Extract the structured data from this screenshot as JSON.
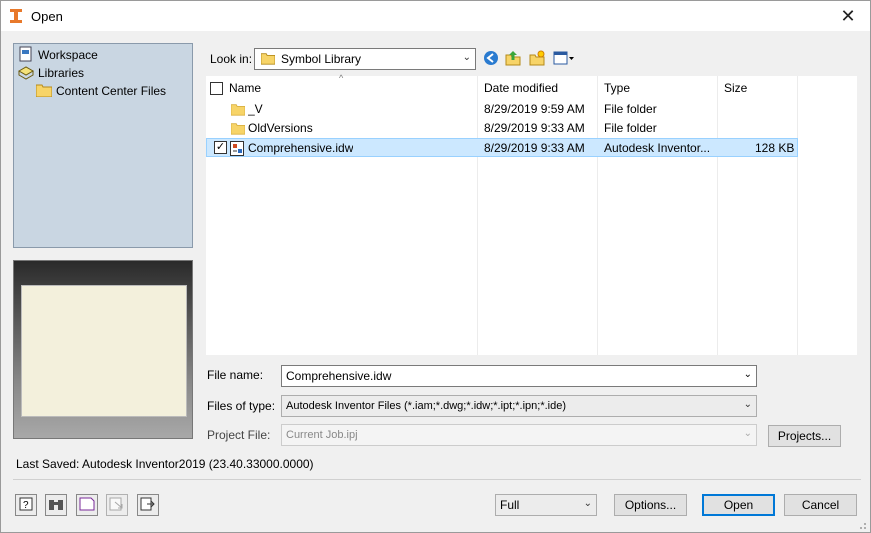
{
  "window": {
    "title": "Open"
  },
  "places": {
    "items": [
      {
        "label": "Workspace",
        "icon": "workspace-icon"
      },
      {
        "label": "Libraries",
        "icon": "libraries-icon"
      },
      {
        "label": "Content Center Files",
        "icon": "folder-icon"
      }
    ]
  },
  "lookin": {
    "label": "Look in:",
    "value": "Symbol Library"
  },
  "filelist": {
    "columns": [
      "Name",
      "Date modified",
      "Type",
      "Size"
    ],
    "rows": [
      {
        "name": "_V",
        "date": "8/29/2019 9:59 AM",
        "type": "File folder",
        "size": "",
        "icon": "folder-icon",
        "selected": false
      },
      {
        "name": "OldVersions",
        "date": "8/29/2019 9:33 AM",
        "type": "File folder",
        "size": "",
        "icon": "folder-icon",
        "selected": false
      },
      {
        "name": "Comprehensive.idw",
        "date": "8/29/2019 9:33 AM",
        "type": "Autodesk Inventor...",
        "size": "128 KB",
        "icon": "drawing-file-icon",
        "selected": true
      }
    ]
  },
  "fields": {
    "file_name_label": "File name:",
    "file_name_value": "Comprehensive.idw",
    "files_of_type_label": "Files of type:",
    "files_of_type_value": "Autodesk Inventor Files (*.iam;*.dwg;*.idw;*.ipt;*.ipn;*.ide)",
    "project_file_label": "Project File:",
    "project_file_value": "Current Job.ipj"
  },
  "buttons": {
    "projects": "Projects...",
    "options": "Options...",
    "open": "Open",
    "cancel": "Cancel"
  },
  "mode": {
    "value": "Full"
  },
  "status": {
    "last_saved": "Last Saved: Autodesk Inventor2019 (23.40.33000.0000)"
  },
  "colors": {
    "selection": "#cce8ff",
    "accent": "#0078d7",
    "places_bg": "#c9d6e2"
  }
}
